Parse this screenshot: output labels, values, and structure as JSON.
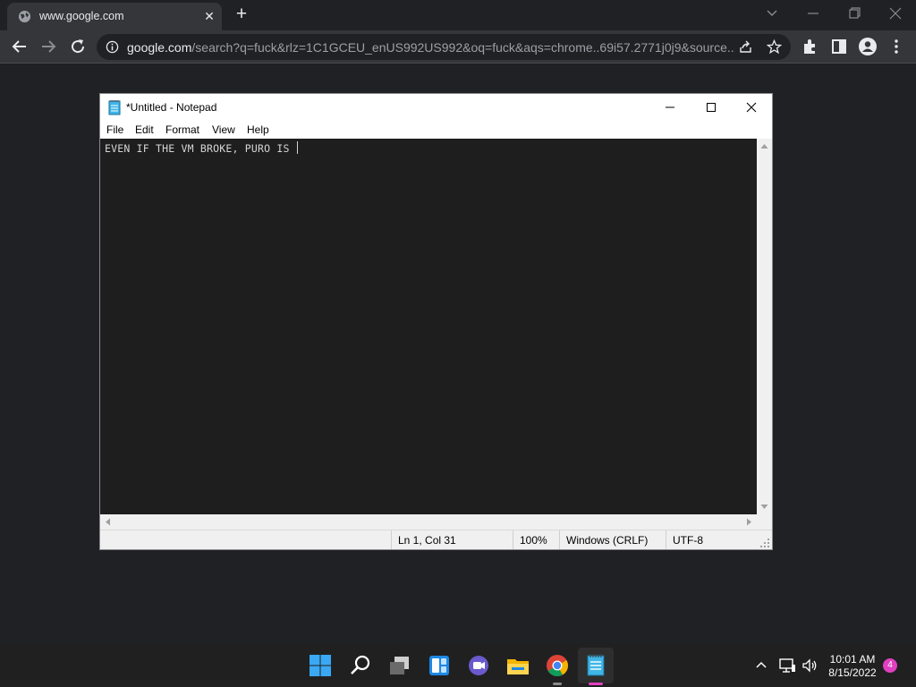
{
  "browser": {
    "tab": {
      "title": "www.google.com",
      "favicon": "globe-icon",
      "close": "✕"
    },
    "new_tab": "+",
    "address_bar": {
      "host": "google.com",
      "path": "/search?q=fuck&rlz=1C1GCEU_enUS992US992&oq=fuck&aqs=chrome..69i57.2771j0j9&source..."
    },
    "icons": [
      "back-icon",
      "forward-icon",
      "reload-icon",
      "site-info-icon",
      "share-icon",
      "bookmark-star-icon",
      "extensions-icon",
      "side-panel-icon",
      "profile-icon",
      "more-icon"
    ],
    "accent": "#35363a"
  },
  "notepad": {
    "title": "*Untitled - Notepad",
    "menu": [
      "File",
      "Edit",
      "Format",
      "View",
      "Help"
    ],
    "text": "EVEN IF THE VM BROKE, PURO IS ",
    "status": {
      "position": "Ln 1, Col 31",
      "zoom": "100%",
      "line_ending": "Windows (CRLF)",
      "encoding": "UTF-8"
    },
    "editor_bg": "#1e1e1e"
  },
  "taskbar": {
    "apps": [
      "start-icon",
      "search-icon",
      "task-view-icon",
      "widgets-icon",
      "teams-chat-icon",
      "file-explorer-icon",
      "chrome-icon",
      "notepad-icon"
    ],
    "clock": {
      "time": "10:01 AM",
      "date": "8/15/2022"
    },
    "notifications": "4",
    "tray_icons": [
      "chevron-up-icon",
      "network-icon",
      "volume-icon"
    ]
  }
}
